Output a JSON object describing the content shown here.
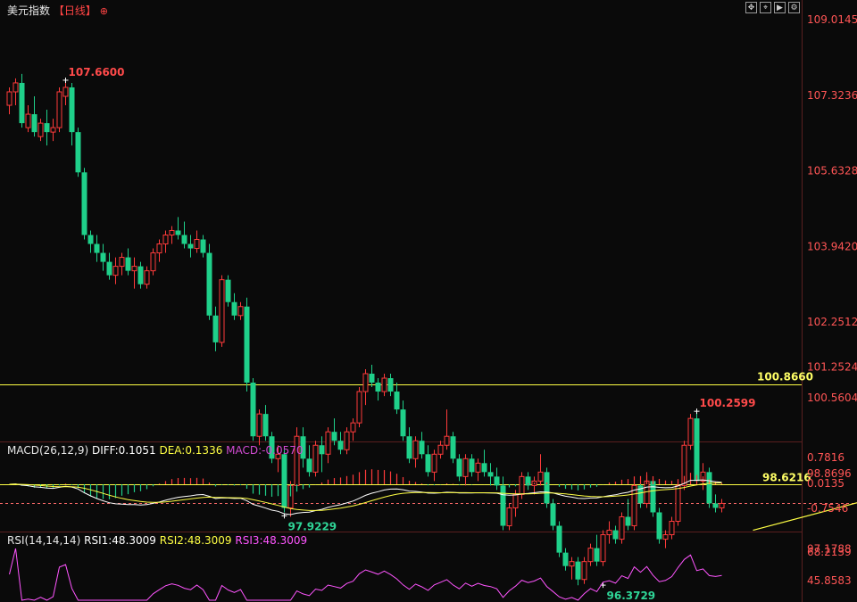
{
  "header": {
    "title": "美元指数",
    "period": "【日线】",
    "zoom_icon": "zoom-in-icon",
    "toolbar": [
      "move-icon",
      "crosshair-icon",
      "play-icon",
      "settings-icon"
    ]
  },
  "colors": {
    "up": "#ff3b3b",
    "down": "#1fd08a",
    "level_line": "#ffff44",
    "price_line": "#ff6a6a",
    "diff": "#ffffff",
    "dea": "#ffff44",
    "macd": "#d24bd2",
    "rsi": "#ff55ff"
  },
  "price_axis": {
    "ticks": [
      "109.0145",
      "107.3236",
      "105.6328",
      "103.9420",
      "102.2512",
      "100.5604",
      "98.8696",
      "97.1788"
    ],
    "extra_label": "101.2524"
  },
  "annotations": {
    "high": "107.6600",
    "low1": "97.9229",
    "low2": "96.3729",
    "recent_high": "100.2599",
    "level_upper": "100.8660",
    "level_lower": "98.6216"
  },
  "macd": {
    "title": "MACD(26,12,9)",
    "diff": "DIFF:0.1051",
    "dea": "DEA:0.1336",
    "macd": "MACD:-0.0570",
    "ticks": [
      "0.7816",
      "0.0135",
      "-0.7546"
    ]
  },
  "rsi": {
    "title": "RSI(14,14,14)",
    "rsi1": "RSI1:48.3009",
    "rsi2": "RSI2:48.3009",
    "rsi3": "RSI3:48.3009",
    "ticks": [
      "68.2139",
      "45.8583"
    ]
  },
  "chart_data": {
    "type": "candlestick",
    "title": "美元指数【日线】",
    "ylim": [
      96.0,
      109.2
    ],
    "horizontal_levels": [
      100.866,
      98.6216
    ],
    "current_price": 98.2,
    "trendline": {
      "from": [
        73,
        95.9
      ],
      "to": [
        119,
        97.6
      ]
    },
    "candles_ohlc": [
      [
        107.1,
        107.5,
        106.9,
        107.4
      ],
      [
        107.4,
        107.7,
        107.1,
        107.6
      ],
      [
        107.6,
        107.8,
        106.6,
        106.7
      ],
      [
        106.6,
        107.1,
        106.5,
        106.9
      ],
      [
        106.9,
        107.3,
        106.4,
        106.5
      ],
      [
        106.4,
        106.8,
        106.3,
        106.7
      ],
      [
        106.7,
        107.0,
        106.2,
        106.5
      ],
      [
        106.5,
        106.8,
        106.3,
        106.6
      ],
      [
        106.6,
        107.5,
        106.5,
        107.4
      ],
      [
        107.3,
        107.7,
        107.1,
        107.5
      ],
      [
        107.5,
        107.6,
        106.2,
        106.5
      ],
      [
        106.5,
        106.6,
        105.5,
        105.6
      ],
      [
        105.6,
        105.7,
        104.1,
        104.2
      ],
      [
        104.2,
        104.3,
        103.8,
        104.0
      ],
      [
        104.0,
        104.2,
        103.6,
        103.8
      ],
      [
        103.8,
        104.0,
        103.4,
        103.6
      ],
      [
        103.6,
        103.8,
        103.2,
        103.3
      ],
      [
        103.3,
        103.7,
        103.1,
        103.5
      ],
      [
        103.5,
        103.8,
        103.3,
        103.7
      ],
      [
        103.7,
        103.9,
        103.3,
        103.4
      ],
      [
        103.4,
        103.7,
        103.0,
        103.5
      ],
      [
        103.5,
        103.6,
        103.0,
        103.1
      ],
      [
        103.1,
        103.5,
        103.0,
        103.4
      ],
      [
        103.4,
        103.9,
        103.3,
        103.8
      ],
      [
        103.8,
        104.1,
        103.6,
        104.0
      ],
      [
        104.0,
        104.3,
        103.8,
        104.2
      ],
      [
        104.2,
        104.4,
        104.0,
        104.3
      ],
      [
        104.3,
        104.6,
        104.1,
        104.2
      ],
      [
        104.2,
        104.5,
        103.9,
        104.0
      ],
      [
        104.0,
        104.2,
        103.7,
        103.9
      ],
      [
        103.9,
        104.3,
        103.8,
        104.1
      ],
      [
        104.1,
        104.2,
        103.7,
        103.8
      ],
      [
        103.8,
        104.0,
        102.3,
        102.4
      ],
      [
        102.4,
        102.6,
        101.6,
        101.8
      ],
      [
        101.8,
        103.3,
        101.7,
        103.2
      ],
      [
        103.2,
        103.3,
        102.6,
        102.7
      ],
      [
        102.7,
        102.9,
        102.3,
        102.4
      ],
      [
        102.4,
        102.7,
        102.3,
        102.6
      ],
      [
        102.6,
        102.8,
        100.7,
        100.9
      ],
      [
        100.9,
        101.0,
        99.6,
        99.7
      ],
      [
        99.7,
        100.3,
        99.5,
        100.2
      ],
      [
        100.2,
        100.4,
        99.6,
        99.7
      ],
      [
        99.7,
        99.8,
        99.1,
        99.2
      ],
      [
        99.2,
        99.5,
        98.9,
        99.3
      ],
      [
        99.3,
        99.4,
        98.0,
        98.1
      ],
      [
        98.1,
        98.7,
        97.9,
        98.6
      ],
      [
        98.6,
        99.9,
        98.5,
        99.7
      ],
      [
        99.7,
        99.9,
        99.0,
        99.2
      ],
      [
        99.2,
        99.5,
        98.8,
        98.9
      ],
      [
        98.9,
        99.6,
        98.8,
        99.5
      ],
      [
        99.5,
        99.7,
        98.9,
        99.3
      ],
      [
        99.3,
        99.9,
        99.1,
        99.8
      ],
      [
        99.8,
        100.1,
        99.5,
        99.6
      ],
      [
        99.6,
        99.8,
        99.3,
        99.4
      ],
      [
        99.4,
        99.9,
        99.3,
        99.8
      ],
      [
        99.8,
        100.1,
        99.6,
        100.0
      ],
      [
        100.0,
        100.8,
        99.9,
        100.7
      ],
      [
        100.7,
        101.2,
        100.4,
        101.1
      ],
      [
        101.1,
        101.3,
        100.8,
        100.9
      ],
      [
        100.9,
        101.0,
        100.5,
        100.7
      ],
      [
        100.7,
        101.1,
        100.6,
        101.0
      ],
      [
        101.0,
        101.1,
        100.6,
        100.7
      ],
      [
        100.7,
        100.9,
        100.2,
        100.3
      ],
      [
        100.3,
        100.5,
        99.6,
        99.7
      ],
      [
        99.7,
        99.9,
        99.1,
        99.2
      ],
      [
        99.2,
        99.7,
        99.0,
        99.6
      ],
      [
        99.6,
        99.8,
        99.2,
        99.3
      ],
      [
        99.3,
        99.5,
        98.8,
        98.9
      ],
      [
        98.9,
        99.4,
        98.7,
        99.3
      ],
      [
        99.3,
        99.6,
        99.2,
        99.5
      ],
      [
        99.5,
        100.3,
        99.4,
        99.7
      ],
      [
        99.7,
        99.8,
        99.1,
        99.2
      ],
      [
        99.2,
        99.3,
        98.7,
        98.8
      ],
      [
        98.8,
        99.3,
        98.6,
        99.2
      ],
      [
        99.2,
        99.3,
        98.8,
        98.9
      ],
      [
        98.9,
        99.2,
        98.7,
        99.1
      ],
      [
        99.1,
        99.4,
        98.8,
        98.9
      ],
      [
        98.9,
        99.1,
        98.6,
        98.8
      ],
      [
        98.8,
        99.0,
        98.5,
        98.6
      ],
      [
        98.6,
        98.8,
        97.6,
        97.7
      ],
      [
        97.7,
        98.2,
        97.6,
        98.1
      ],
      [
        98.1,
        98.5,
        97.9,
        98.4
      ],
      [
        98.4,
        98.9,
        98.3,
        98.8
      ],
      [
        98.8,
        98.9,
        98.5,
        98.6
      ],
      [
        98.6,
        98.8,
        98.4,
        98.7
      ],
      [
        98.7,
        99.3,
        98.6,
        98.9
      ],
      [
        98.9,
        99.0,
        98.1,
        98.2
      ],
      [
        98.2,
        98.3,
        97.6,
        97.7
      ],
      [
        97.7,
        97.8,
        97.0,
        97.1
      ],
      [
        97.1,
        97.2,
        96.7,
        96.8
      ],
      [
        96.8,
        97.0,
        96.5,
        96.9
      ],
      [
        96.9,
        97.0,
        96.37,
        96.5
      ],
      [
        96.5,
        97.0,
        96.4,
        96.9
      ],
      [
        96.9,
        97.3,
        96.8,
        97.2
      ],
      [
        97.2,
        97.5,
        96.8,
        96.9
      ],
      [
        96.9,
        97.6,
        96.8,
        97.5
      ],
      [
        97.5,
        97.8,
        97.3,
        97.6
      ],
      [
        97.6,
        97.7,
        97.3,
        97.4
      ],
      [
        97.4,
        98.0,
        97.3,
        97.9
      ],
      [
        97.9,
        98.3,
        97.6,
        97.7
      ],
      [
        97.7,
        98.8,
        97.6,
        98.6
      ],
      [
        98.6,
        98.8,
        98.1,
        98.2
      ],
      [
        98.2,
        98.9,
        98.1,
        98.7
      ],
      [
        98.7,
        98.8,
        97.9,
        98.0
      ],
      [
        98.0,
        98.1,
        97.3,
        97.4
      ],
      [
        97.4,
        97.6,
        97.2,
        97.5
      ],
      [
        97.5,
        97.9,
        97.4,
        97.8
      ],
      [
        97.8,
        98.7,
        97.7,
        98.6
      ],
      [
        98.6,
        99.6,
        98.5,
        99.5
      ],
      [
        99.5,
        100.2,
        99.4,
        100.1
      ],
      [
        100.1,
        100.26,
        99.7,
        98.7
      ],
      [
        98.7,
        99.1,
        98.5,
        98.9
      ],
      [
        98.9,
        99.0,
        98.1,
        98.2
      ],
      [
        98.2,
        98.4,
        98.0,
        98.1
      ],
      [
        98.1,
        98.3,
        98.0,
        98.2
      ]
    ]
  }
}
